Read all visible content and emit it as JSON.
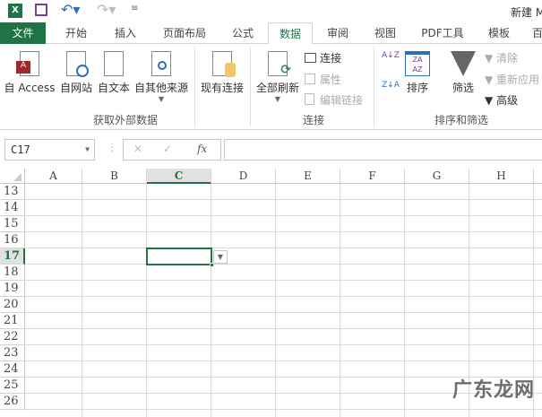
{
  "titlebar": {
    "title": "新建 M"
  },
  "tabs": [
    {
      "label": "文件"
    },
    {
      "label": "开始"
    },
    {
      "label": "插入"
    },
    {
      "label": "页面布局"
    },
    {
      "label": "公式"
    },
    {
      "label": "数据"
    },
    {
      "label": "审阅"
    },
    {
      "label": "视图"
    },
    {
      "label": "PDF工具"
    },
    {
      "label": "模板"
    },
    {
      "label": "百"
    }
  ],
  "ribbon": {
    "get_external": {
      "group": "获取外部数据",
      "access": "自 Access",
      "web": "自网站",
      "text": "自文本",
      "other": "自其他来源",
      "existing": "现有连接"
    },
    "connections": {
      "group": "连接",
      "refresh_all": "全部刷新",
      "connections": "连接",
      "properties": "属性",
      "edit_links": "编辑链接"
    },
    "sort_filter": {
      "group": "排序和筛选",
      "sort": "排序",
      "filter": "筛选",
      "clear": "清除",
      "reapply": "重新应用",
      "advanced": "高级",
      "az": "A↓Z",
      "za": "Z↓A"
    }
  },
  "formula_bar": {
    "name_box": "C17",
    "cancel": "✕",
    "enter": "✓",
    "fx": "fx",
    "value": ""
  },
  "columns": [
    "A",
    "B",
    "C",
    "D",
    "E",
    "F",
    "G",
    "H"
  ],
  "rows": [
    "13",
    "14",
    "15",
    "16",
    "17",
    "18",
    "19",
    "20",
    "21",
    "22",
    "23",
    "24",
    "25",
    "26"
  ],
  "active_cell": "C17",
  "watermark": "广东龙网",
  "colors": {
    "accent": "#217346"
  }
}
